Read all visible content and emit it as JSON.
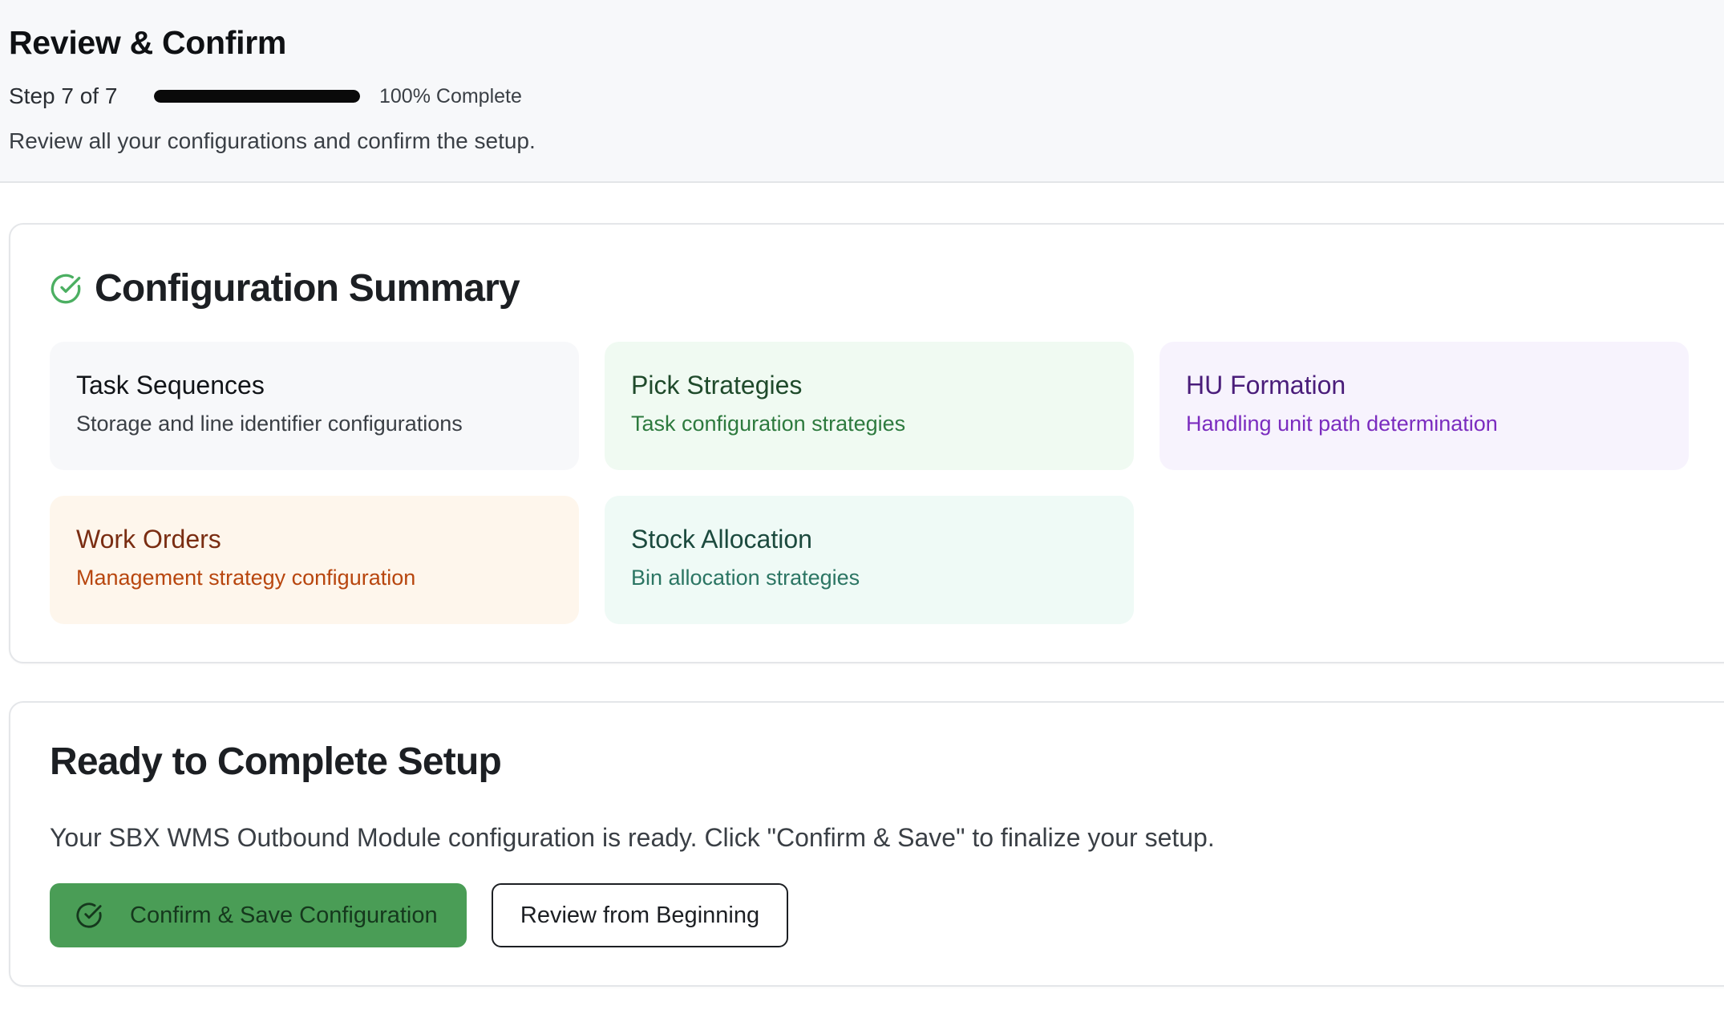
{
  "header": {
    "title": "Review & Confirm",
    "step_label": "Step 7 of 7",
    "progress_percent": 100,
    "progress_text": "100% Complete",
    "description": "Review all your configurations and confirm the setup."
  },
  "summary": {
    "icon": "check-circle-icon",
    "title": "Configuration Summary",
    "tiles": [
      {
        "title": "Task Sequences",
        "description": "Storage and line identifier configurations"
      },
      {
        "title": "Pick Strategies",
        "description": "Task configuration strategies"
      },
      {
        "title": "HU Formation",
        "description": "Handling unit path determination"
      },
      {
        "title": "Work Orders",
        "description": "Management strategy configuration"
      },
      {
        "title": "Stock Allocation",
        "description": "Bin allocation strategies"
      }
    ]
  },
  "ready": {
    "title": "Ready to Complete Setup",
    "description": "Your SBX WMS Outbound Module configuration is ready. Click \"Confirm & Save\" to finalize your setup.",
    "confirm_label": "Confirm & Save Configuration",
    "confirm_icon": "check-circle-icon",
    "review_label": "Review from Beginning"
  },
  "colors": {
    "accent_green": "#4a9d56",
    "progress_fill": "#0a0a0a",
    "check_icon": "#4caf62"
  }
}
